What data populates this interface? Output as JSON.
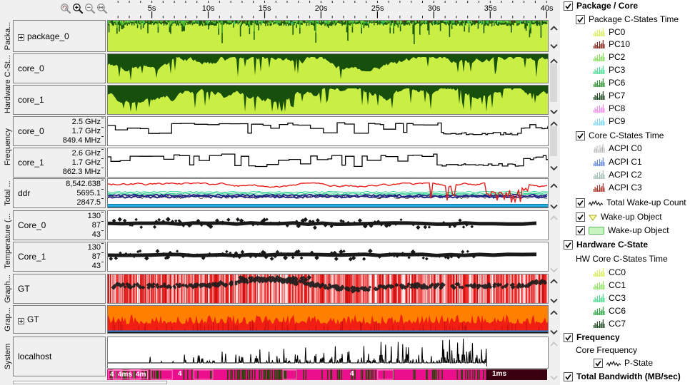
{
  "toolbar": {
    "icons": [
      {
        "name": "zoom-back"
      },
      {
        "name": "zoom-in"
      },
      {
        "name": "zoom-out"
      },
      {
        "name": "zoom-reset"
      }
    ]
  },
  "axis": {
    "labels": [
      "5s",
      "10s",
      "15s",
      "20s",
      "25s",
      "30s",
      "35s",
      "40s"
    ]
  },
  "row_groups": [
    {
      "label": "Packa..."
    },
    {
      "label": "Hardware C-St..."
    },
    {
      "label": "Frequency"
    },
    {
      "label": "Total ..."
    },
    {
      "label": "Temperature (..."
    },
    {
      "label": "Graph..."
    },
    {
      "label": "Grap..."
    },
    {
      "label": "System"
    }
  ],
  "rows": [
    {
      "label": "package_0",
      "expand": true,
      "scale": [],
      "type": "pkg"
    },
    {
      "label": "core_0",
      "expand": false,
      "scale": [],
      "type": "cstate"
    },
    {
      "label": "core_1",
      "expand": false,
      "scale": [],
      "type": "cstate"
    },
    {
      "label": "core_0",
      "expand": false,
      "scale": [
        "2.5 GHz",
        "1.7 GHz",
        "849.4 MHz"
      ],
      "type": "freq"
    },
    {
      "label": "core_1",
      "expand": false,
      "scale": [
        "2.6 GHz",
        "1.7 GHz",
        "862.3 MHz"
      ],
      "type": "freq"
    },
    {
      "label": "ddr",
      "expand": false,
      "scale": [
        "8,542.638",
        "5695.1",
        "2847.5"
      ],
      "type": "ddr"
    },
    {
      "label": "Core_0",
      "expand": false,
      "scale": [
        "130",
        "87",
        "43"
      ],
      "type": "temp"
    },
    {
      "label": "Core_1",
      "expand": false,
      "scale": [
        "130",
        "87",
        "43"
      ],
      "type": "temp"
    },
    {
      "label": "GT",
      "expand": false,
      "scale": [],
      "type": "gt1"
    },
    {
      "label": "GT",
      "expand": true,
      "scale": [],
      "type": "gt2"
    },
    {
      "label": "localhost",
      "expand": false,
      "scale": [],
      "type": "host"
    }
  ],
  "bottom_bar": {
    "split": 0.861,
    "labels": [
      {
        "text": "4",
        "chip": true,
        "pos": 0.002
      },
      {
        "text": "4ms",
        "chip": true,
        "pos": 0.02
      },
      {
        "text": "4m",
        "chip": true,
        "pos": 0.06
      },
      {
        "text": "4",
        "chip": false,
        "pos": 0.158
      },
      {
        "text": "4",
        "chip": false,
        "pos": 0.548
      },
      {
        "text": "1ms",
        "chip": false,
        "pos": 0.872
      }
    ]
  },
  "legend": {
    "items": [
      {
        "label": "Package / Core",
        "level": 0,
        "checkbox": true,
        "checked": true,
        "bold": true
      },
      {
        "label": "Package C-States Time",
        "level": 1,
        "checkbox": true,
        "checked": true
      },
      {
        "label": "PC0",
        "level": 2,
        "icon": "hist",
        "color": "#d7ef54"
      },
      {
        "label": "PC10",
        "level": 2,
        "icon": "hist",
        "color": "#7c150c"
      },
      {
        "label": "PC2",
        "level": 2,
        "icon": "hist",
        "color": "#7fdc52"
      },
      {
        "label": "PC3",
        "level": 2,
        "icon": "hist",
        "color": "#3fdf91"
      },
      {
        "label": "PC6",
        "level": 2,
        "icon": "hist",
        "color": "#1d8c22"
      },
      {
        "label": "PC7",
        "level": 2,
        "icon": "hist",
        "color": "#0d3a10"
      },
      {
        "label": "PC8",
        "level": 2,
        "icon": "hist",
        "color": "#ef86e8"
      },
      {
        "label": "PC9",
        "level": 2,
        "icon": "hist",
        "color": "#7cd7f2"
      },
      {
        "label": "Core C-States Time",
        "level": 1,
        "checkbox": true,
        "checked": true
      },
      {
        "label": "ACPI C0",
        "level": 2,
        "icon": "hist",
        "color": "#ffffff",
        "stroke": "#b0b0b0"
      },
      {
        "label": "ACPI C1",
        "level": 2,
        "icon": "hist",
        "color": "#5f83d8"
      },
      {
        "label": "ACPI C2",
        "level": 2,
        "icon": "hist",
        "color": "#9fbcb2"
      },
      {
        "label": "ACPI C3",
        "level": 2,
        "icon": "hist",
        "color": "#a6261a"
      },
      {
        "label": "Total Wake-up Count",
        "level": 1,
        "checkbox": true,
        "checked": true,
        "icon": "line",
        "color": "#111111"
      },
      {
        "label": "Wake-up Object",
        "level": 1,
        "checkbox": true,
        "checked": true,
        "icon": "tri",
        "color": "#ffffa8"
      },
      {
        "label": "Wake-up Object",
        "level": 1,
        "checkbox": true,
        "checked": true,
        "icon": "rect",
        "color": "#c8f4c0"
      },
      {
        "label": "Hardware C-State",
        "level": 0,
        "checkbox": true,
        "checked": true,
        "bold": true
      },
      {
        "label": "HW Core C-States Time",
        "level": 1
      },
      {
        "label": "CC0",
        "level": 2,
        "icon": "hist",
        "color": "#d7ef54"
      },
      {
        "label": "CC1",
        "level": 2,
        "icon": "hist",
        "color": "#8ae15e"
      },
      {
        "label": "CC3",
        "level": 2,
        "icon": "hist",
        "color": "#41da8b"
      },
      {
        "label": "CC6",
        "level": 2,
        "icon": "hist",
        "color": "#1fa339"
      },
      {
        "label": "CC7",
        "level": 2,
        "icon": "hist",
        "color": "#103c12"
      },
      {
        "label": "Frequency",
        "level": 0,
        "checkbox": true,
        "checked": true,
        "bold": true
      },
      {
        "label": "Core Frequency",
        "level": 1
      },
      {
        "label": "P-State",
        "level": 2,
        "checkbox": true,
        "checked": true,
        "icon": "line",
        "color": "#111111"
      },
      {
        "label": "Total Bandwidth (MB/sec)",
        "level": 0,
        "checkbox": true,
        "checked": true,
        "bold": true
      }
    ]
  },
  "palette": {
    "lime": "#c9ef45",
    "dark_green": "#1b5a10",
    "mid_green": "#49b52b",
    "bright_green": "#7ee04e",
    "spring": "#2ee08a",
    "cstate_dark": "#174f0c",
    "ddr_red": "#e51d1a",
    "ddr_teal": "#2fd08c",
    "ddr_navy": "#232384",
    "ddr_gray": "#4a4a4a",
    "ddr_cyan": "#29b6ea",
    "temp_line": "#1a1a1a",
    "gt_diamond": "#1b1b1b",
    "orange": "#ff8000",
    "gt2_red": "#f01e14",
    "gt2_blue": "#1787d8",
    "host_line": "#000000",
    "bar_magenta": "#ec0f8d",
    "bar_maroon": "#3a000f",
    "bar_tick": "#1e4a00"
  }
}
